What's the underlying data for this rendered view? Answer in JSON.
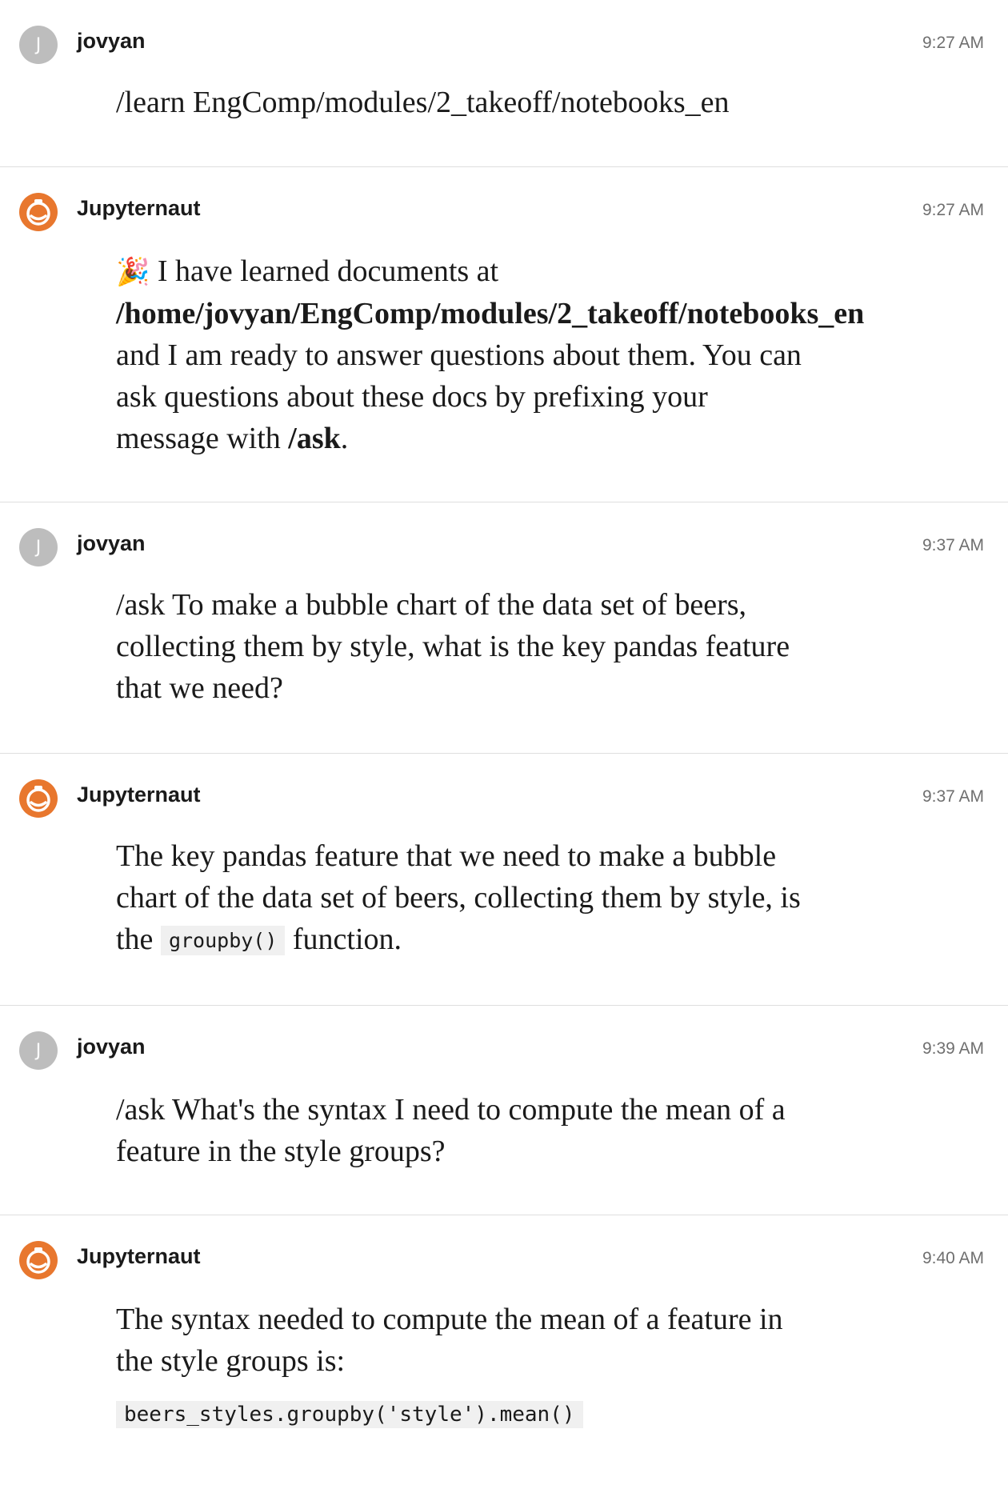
{
  "messages": [
    {
      "sender": "jovyan",
      "avatar_letter": "J",
      "time": "9:27 AM",
      "text": "/learn EngComp/modules/2_takeoff/notebooks_en"
    },
    {
      "sender": "Jupyternaut",
      "time": "9:27 AM",
      "emoji": "🎉",
      "text_before": " I have learned documents at",
      "path": "/home/jovyan/EngComp/modules/2_takeoff/notebooks_en",
      "text_middle": "and I am ready to answer questions about them. You can ask questions about these docs by prefixing your message with ",
      "command": "/ask",
      "text_end": "."
    },
    {
      "sender": "jovyan",
      "avatar_letter": "J",
      "time": "9:37 AM",
      "text": "/ask To make a bubble chart of the data set of beers, collecting them by style, what is the key pandas feature that we need?"
    },
    {
      "sender": "Jupyternaut",
      "time": "9:37 AM",
      "text_before": "The key pandas feature that we need to make a bubble chart of the data set of beers, collecting them by style, is the ",
      "code": "groupby()",
      "text_after": " function."
    },
    {
      "sender": "jovyan",
      "avatar_letter": "J",
      "time": "9:39 AM",
      "text": "/ask What's the syntax I need to compute the mean of a feature in the style groups?"
    },
    {
      "sender": "Jupyternaut",
      "time": "9:40 AM",
      "text": "The syntax needed to compute the mean of a feature in the style groups is:",
      "code": "beers_styles.groupby('style').mean()"
    }
  ]
}
